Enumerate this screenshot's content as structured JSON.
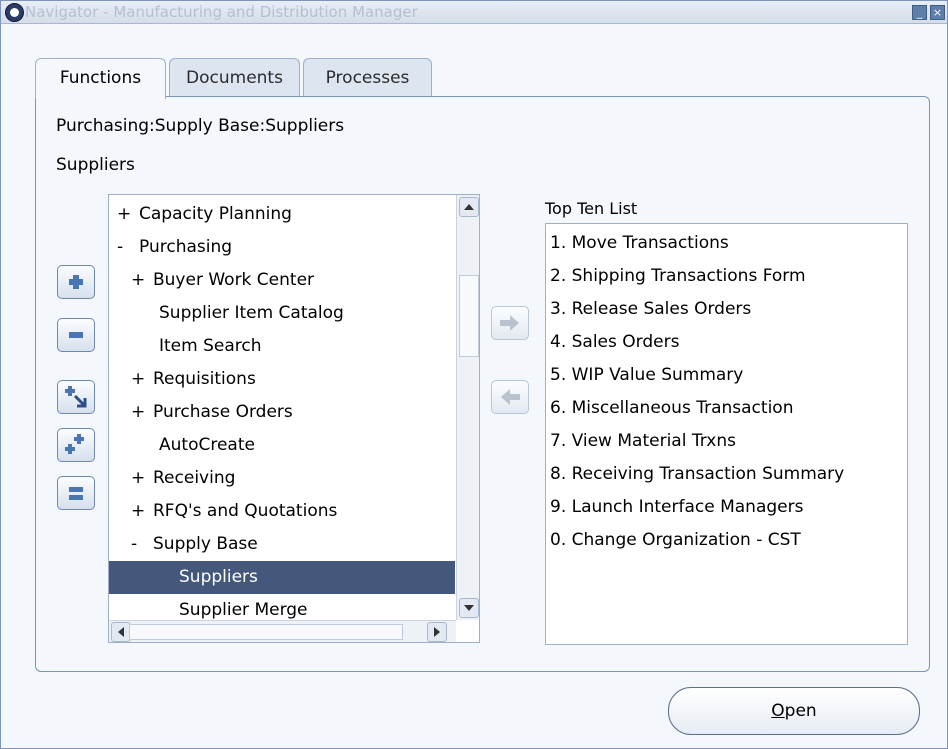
{
  "window": {
    "title": "Navigator - Manufacturing and Distribution Manager",
    "minimize_glyph": "_",
    "close_glyph": "×"
  },
  "tabs": [
    {
      "label": "Functions"
    },
    {
      "label": "Documents"
    },
    {
      "label": "Processes"
    }
  ],
  "breadcrumb": "Purchasing:Supply Base:Suppliers",
  "selected_label": "Suppliers",
  "tree": {
    "items": [
      {
        "prefix": "+",
        "label": "Capacity Planning",
        "level": 0
      },
      {
        "prefix": "-",
        "label": "Purchasing",
        "level": 0
      },
      {
        "prefix": "+",
        "label": "Buyer Work Center",
        "level": 1
      },
      {
        "prefix": "",
        "label": "Supplier Item Catalog",
        "level": 1
      },
      {
        "prefix": "",
        "label": "Item Search",
        "level": 1
      },
      {
        "prefix": "+",
        "label": "Requisitions",
        "level": 1
      },
      {
        "prefix": "+",
        "label": "Purchase Orders",
        "level": 1
      },
      {
        "prefix": "",
        "label": "AutoCreate",
        "level": 1
      },
      {
        "prefix": "+",
        "label": "Receiving",
        "level": 1
      },
      {
        "prefix": "+",
        "label": "RFQ's and Quotations",
        "level": 1
      },
      {
        "prefix": "-",
        "label": "Supply Base",
        "level": 1
      },
      {
        "prefix": "",
        "label": "Suppliers",
        "level": 2,
        "selected": true
      },
      {
        "prefix": "",
        "label": "Supplier Merge",
        "level": 2
      }
    ]
  },
  "side_buttons": [
    {
      "icon": "expand-icon"
    },
    {
      "icon": "collapse-icon"
    },
    {
      "icon": "expand-branch-icon"
    },
    {
      "icon": "expand-all-icon"
    },
    {
      "icon": "collapse-all-icon"
    }
  ],
  "top_ten": {
    "title": "Top Ten List",
    "items": [
      "1. Move Transactions",
      "2. Shipping Transactions Form",
      "3. Release Sales Orders",
      "4. Sales Orders",
      "5. WIP Value Summary",
      "6. Miscellaneous Transaction",
      "7. View Material Trxns",
      "8. Receiving Transaction Summary",
      "9. Launch Interface Managers",
      "0. Change Organization - CST"
    ]
  },
  "open_button": {
    "accel": "O",
    "rest": "pen"
  },
  "colors": {
    "selection": "#44587c",
    "border": "#7d95b8",
    "background": "#f4f7fb"
  }
}
